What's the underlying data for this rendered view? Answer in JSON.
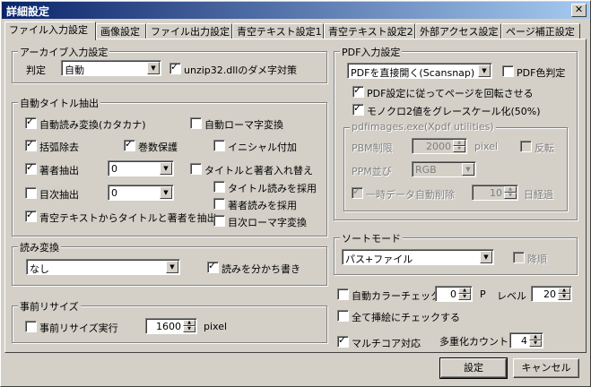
{
  "window": {
    "title": "詳細設定"
  },
  "tabs": [
    "ファイル入力設定",
    "画像設定",
    "ファイル出力設定",
    "青空テキスト設定1",
    "青空テキスト設定2",
    "外部アクセス設定",
    "ページ補正設定"
  ],
  "archive": {
    "legend": "アーカイブ入力設定",
    "judge_label": "判定",
    "judge_value": "自動",
    "unzip_label": "unzip32.dllのダメ字対策"
  },
  "auto_title": {
    "legend": "自動タイトル抽出",
    "auto_read_conv": "自動読み変換(カタカナ)",
    "auto_roman": "自動ローマ字変換",
    "remove_brackets": "括弧除去",
    "keep_volume": "巻数保護",
    "add_initial": "イニシャル付加",
    "author_extract": "著者抽出",
    "author_combo": "0",
    "swap_title_author": "タイトルと著者入れ替え",
    "toc_extract": "目次抽出",
    "toc_combo": "0",
    "use_title_reading": "タイトル読みを採用",
    "use_author_reading": "著者読みを採用",
    "toc_roman": "目次ローマ字変換",
    "aozora_extract": "青空テキストからタイトルと著者を抽出"
  },
  "reading": {
    "legend": "読み変換",
    "value": "なし",
    "separate": "読みを分かち書き"
  },
  "resize": {
    "legend": "事前リサイズ",
    "run_label": "事前リサイズ実行",
    "value": "1600",
    "unit": "pixel"
  },
  "pdf": {
    "legend": "PDF入力設定",
    "mode": "PDFを直接開く(Scansnap)",
    "color_judge": "PDF色判定",
    "rotate": "PDF設定に従ってページを回転させる",
    "mono_gray": "モノクロ2値をグレースケール化(50%)",
    "xpdf_legend": "pdfimages.exe(Xpdf utilities)",
    "pbm_label": "PBM制限",
    "pbm_value": "2000",
    "pbm_unit": "pixel",
    "invert": "反転",
    "ppm_label": "PPM並び",
    "ppm_value": "RGB",
    "temp_delete": "一時データ自動削除",
    "days_value": "10",
    "days_unit": "日経過"
  },
  "sort": {
    "legend": "ソートモード",
    "value": "パス+ファイル",
    "desc": "降順"
  },
  "misc": {
    "auto_color": "自動カラーチェック",
    "p_value": "0",
    "p_unit": "P",
    "level_label": "レベル",
    "level_value": "20",
    "all_scribble": "全て挿絵にチェックする",
    "multicore": "マルチコア対応",
    "multi_label": "多重化カウント",
    "multi_value": "4"
  },
  "buttons": {
    "ok": "設定",
    "cancel": "キャンセル"
  }
}
